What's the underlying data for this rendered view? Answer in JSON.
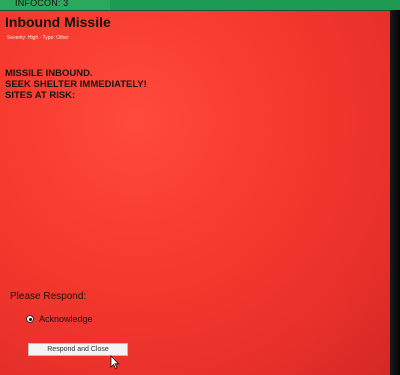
{
  "top_bar": {
    "infocon_label": "INFOCON: 3",
    "bar_color": "#1f9a52"
  },
  "alert": {
    "title": "Inbound Missile",
    "meta": "Severity: High · Type: Other",
    "message_lines": [
      "MISSILE INBOUND.",
      "SEEK SHELTER IMMEDIATELY!",
      "SITES AT RISK:"
    ],
    "background_color": "#f63a2e"
  },
  "response": {
    "prompt": "Please Respond:",
    "option_label": "Acknowledge",
    "option_selected": true,
    "button_label": "Respond and Close"
  }
}
